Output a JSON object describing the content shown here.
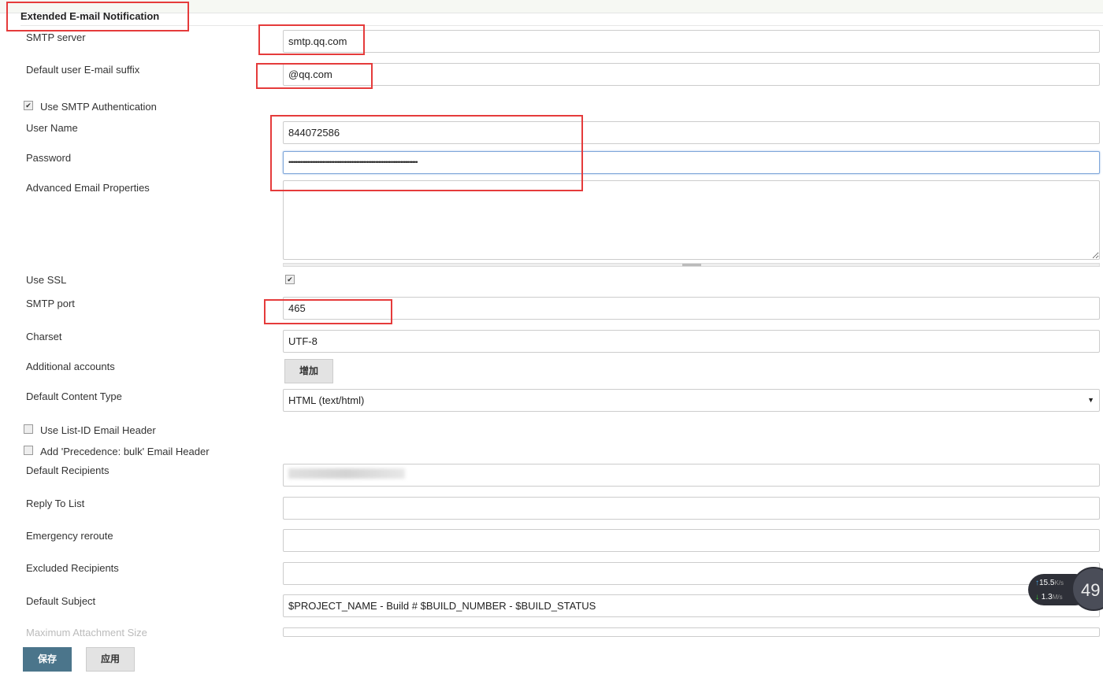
{
  "section_title": "Extended E-mail Notification",
  "fields": {
    "smtp_server": {
      "label": "SMTP server",
      "value": "smtp.qq.com"
    },
    "suffix": {
      "label": "Default user E-mail suffix",
      "value": "@qq.com"
    },
    "use_auth": {
      "label": "Use SMTP Authentication",
      "checked": true
    },
    "username": {
      "label": "User Name",
      "value": "844072586"
    },
    "password": {
      "label": "Password",
      "value": "••••••••••••••••••••••••••••••••••••••••••••••••••••••••••••••••••••••••••••"
    },
    "advanced": {
      "label": "Advanced Email Properties",
      "value": ""
    },
    "use_ssl": {
      "label": "Use SSL",
      "checked": true
    },
    "smtp_port": {
      "label": "SMTP port",
      "value": "465"
    },
    "charset": {
      "label": "Charset",
      "value": "UTF-8"
    },
    "additional_accounts": {
      "label": "Additional accounts",
      "button": "增加"
    },
    "content_type": {
      "label": "Default Content Type",
      "value": "HTML (text/html)"
    },
    "list_id": {
      "label": "Use List-ID Email Header",
      "checked": false
    },
    "precedence": {
      "label": "Add 'Precedence: bulk' Email Header",
      "checked": false
    },
    "recipients": {
      "label": "Default Recipients",
      "value": ""
    },
    "reply_to": {
      "label": "Reply To List",
      "value": ""
    },
    "emergency": {
      "label": "Emergency reroute",
      "value": ""
    },
    "excluded": {
      "label": "Excluded Recipients",
      "value": ""
    },
    "subject": {
      "label": "Default Subject",
      "value": "$PROJECT_NAME - Build # $BUILD_NUMBER - $BUILD_STATUS"
    },
    "max_attach": {
      "label": "Maximum Attachment Size",
      "value": ""
    }
  },
  "buttons": {
    "save": "保存",
    "apply": "应用"
  },
  "net_widget": {
    "up": "15.5",
    "up_unit": "K/s",
    "down": "1.3",
    "down_unit": "M/s",
    "percent": "49"
  }
}
